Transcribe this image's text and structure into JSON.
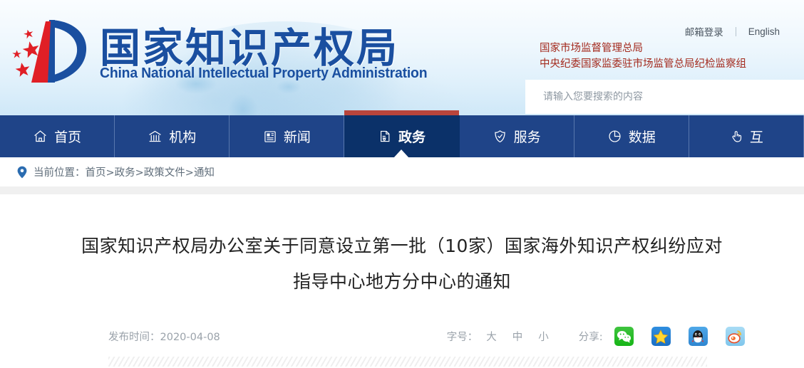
{
  "header": {
    "logo": {
      "icon": "cnipa-emblem-logo"
    },
    "site_title_cn": "国家知识产权局",
    "site_title_en": "China National Intellectual Property Administration",
    "top_links": [
      {
        "label": "邮箱登录",
        "name": "mail-login-link"
      },
      {
        "label": "English",
        "name": "english-link"
      }
    ],
    "agency_line_1": "国家市场监督管理总局",
    "agency_line_2": "中央纪委国家监委驻市场监管总局纪检监察组",
    "search": {
      "placeholder": "请输入您要搜索的内容",
      "value": ""
    },
    "colors": {
      "brand_blue": "#1a4fa0",
      "agency_red": "#a32a1d",
      "nav_blue": "#1f4488",
      "nav_active": "#0b3169",
      "accent_red": "#b9453c"
    }
  },
  "nav": {
    "items": [
      {
        "label": "首页",
        "icon": "home-icon",
        "active": false
      },
      {
        "label": "机构",
        "icon": "bank-icon",
        "active": false
      },
      {
        "label": "新闻",
        "icon": "newspaper-icon",
        "active": false
      },
      {
        "label": "政务",
        "icon": "document-icon",
        "active": true
      },
      {
        "label": "服务",
        "icon": "shield-check-icon",
        "active": false
      },
      {
        "label": "数据",
        "icon": "pie-chart-icon",
        "active": false
      },
      {
        "label": "互",
        "icon": "hand-click-icon",
        "active": false
      }
    ]
  },
  "breadcrumb": {
    "icon": "location-pin-icon",
    "label": "当前位置：",
    "path": "首页>政务>政策文件>通知"
  },
  "article": {
    "title": "国家知识产权局办公室关于同意设立第一批（10家）国家海外知识产权纠纷应对指导中心地方分中心的通知",
    "publish_label": "发布时间：",
    "publish_date": "2020-04-08",
    "fontsize_label": "字号：",
    "fontsize_options": [
      "大",
      "中",
      "小"
    ],
    "share_label": "分享:",
    "share_targets": [
      {
        "name": "wechat-share-icon",
        "label": "微信"
      },
      {
        "name": "qzone-share-icon",
        "label": "QQ空间"
      },
      {
        "name": "qq-share-icon",
        "label": "QQ"
      },
      {
        "name": "weibo-share-icon",
        "label": "新浪微博"
      }
    ]
  }
}
